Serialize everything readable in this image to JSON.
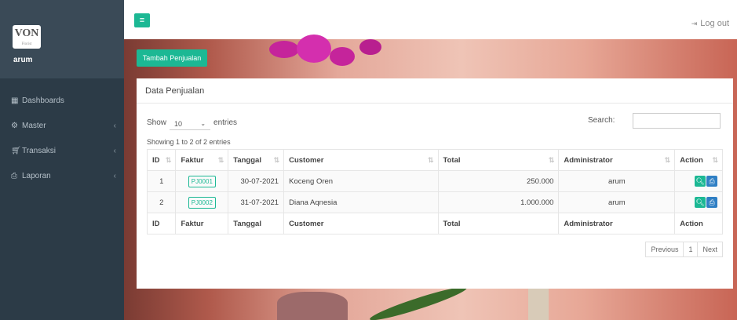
{
  "sidebar": {
    "logo_text": "VON",
    "logo_sub": "Florist",
    "user": "arum",
    "items": [
      {
        "icon": "dashboard-icon",
        "label": "Dashboards"
      },
      {
        "icon": "master-icon",
        "label": "Master",
        "chevron": "‹"
      },
      {
        "icon": "cart-icon",
        "label": "Transaksi",
        "chevron": "‹"
      },
      {
        "icon": "printer-icon",
        "label": "Laporan",
        "chevron": "‹"
      }
    ]
  },
  "topbar": {
    "toggle_icon": "≡",
    "logout": "Log out"
  },
  "add_button": "Tambah Penjualan",
  "panel": {
    "title": "Data Penjualan",
    "show": "Show",
    "entries_value": "10",
    "entries": "entries",
    "search_label": "Search:",
    "info": "Showing 1 to 2 of 2 entries",
    "columns": [
      "ID",
      "Faktur",
      "Tanggal",
      "Customer",
      "Total",
      "Administrator",
      "Action"
    ],
    "rows": [
      {
        "id": "1",
        "faktur": "PJ0001",
        "tanggal": "30-07-2021",
        "customer": "Koceng Oren",
        "total": "250.000",
        "admin": "arum"
      },
      {
        "id": "2",
        "faktur": "PJ0002",
        "tanggal": "31-07-2021",
        "customer": "Diana Aqnesia",
        "total": "1.000.000",
        "admin": "arum"
      }
    ],
    "pager": {
      "previous": "Previous",
      "page": "1",
      "next": "Next"
    }
  },
  "colors": {
    "accent": "#1cb894",
    "print": "#2f7fc4",
    "sidebar": "#2c3b47"
  }
}
